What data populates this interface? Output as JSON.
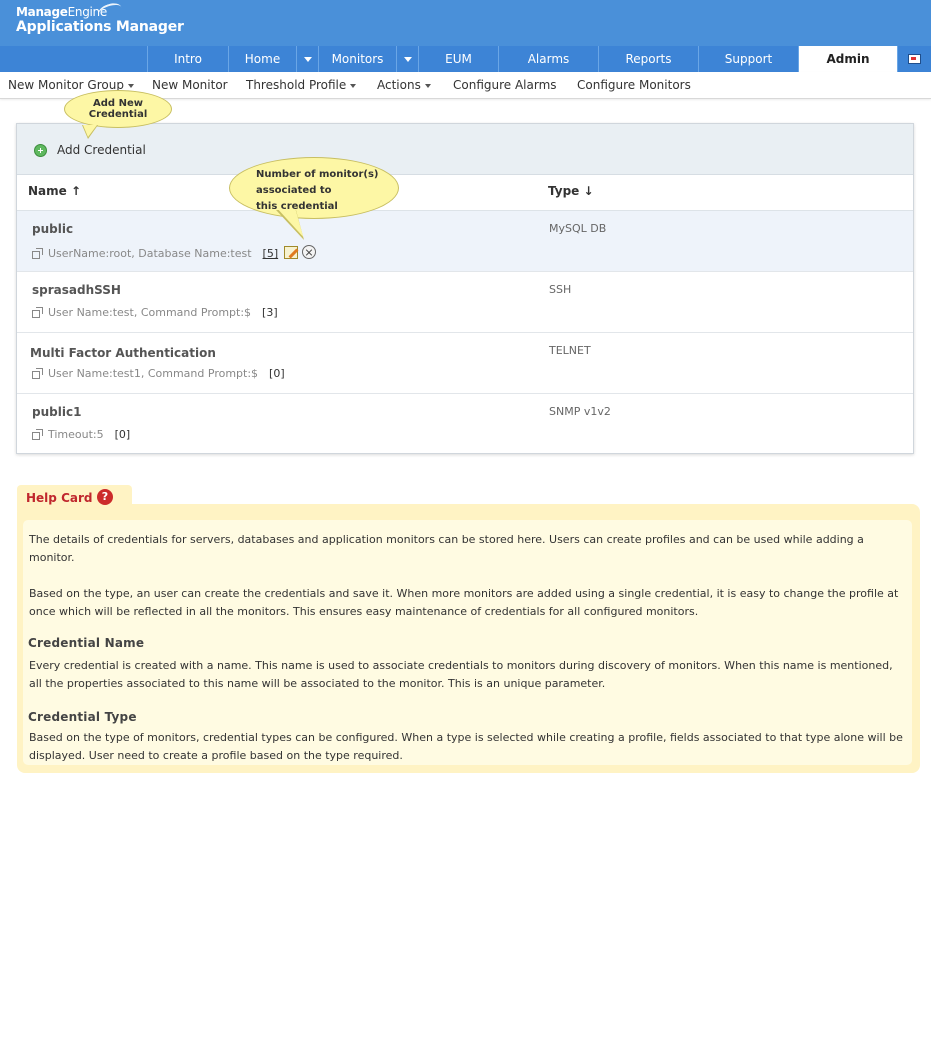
{
  "app": {
    "brand_prefix": "Manage",
    "brand_suffix": "Engine",
    "product": "Applications Manager"
  },
  "tabs": [
    {
      "label": "Intro"
    },
    {
      "label": "Home"
    },
    {
      "label": "Monitors"
    },
    {
      "label": "EUM"
    },
    {
      "label": "Alarms"
    },
    {
      "label": "Reports"
    },
    {
      "label": "Support"
    },
    {
      "label": "Admin",
      "active": true
    }
  ],
  "subnav": {
    "new_monitor_group": "New Monitor Group",
    "new_monitor": "New Monitor",
    "threshold_profile": "Threshold Profile",
    "actions": "Actions",
    "configure_alarms": "Configure Alarms",
    "configure_monitors": "Configure Monitors"
  },
  "callouts": {
    "add_new_line1": "Add New",
    "add_new_line2": "Credential",
    "count_line1": "Number of monitor(s)",
    "count_line2": "associated to",
    "count_line3": "this credential"
  },
  "panel": {
    "add_label": "Add Credential",
    "col_name": "Name",
    "col_name_sort": "↑",
    "col_type": "Type",
    "col_type_sort": "↓",
    "rows": [
      {
        "name": "public",
        "type": "MySQL DB",
        "details": "UserName:root, Database Name:test",
        "count": "[5]"
      },
      {
        "name": "sprasadhSSH",
        "type": "SSH",
        "details": "User Name:test, Command Prompt:$",
        "count": "[3]"
      },
      {
        "name": "Multi Factor Authentication",
        "type": "TELNET",
        "details": "User Name:test1, Command Prompt:$",
        "count": "[0]"
      },
      {
        "name": "public1",
        "type": "SNMP v1v2",
        "details": "Timeout:5",
        "count": "[0]"
      }
    ]
  },
  "help": {
    "title": "Help Card",
    "q_mark": "?",
    "p1": "The details of credentials for servers, databases and application monitors can be stored here. Users can create profiles and can be used while adding a monitor.",
    "p2": "Based on the type, an user can create the credentials and save it. When more monitors are added using a single credential, it is easy to change the profile at once which will be reflected in all the monitors. This ensures easy maintenance of credentials for all configured monitors.",
    "h1": "Credential Name",
    "p3": "Every credential is created with a name. This name is used to associate credentials to monitors during discovery of monitors. When this name is mentioned, all the properties associated to this name will be associated to the monitor. This is an unique parameter.",
    "h2": "Credential Type",
    "p4": "Based on the type of monitors, credential types can be configured. When a type is selected while creating a profile, fields associated to that type alone will be displayed. User need to create a profile based on the type required."
  },
  "colors": {
    "header_blue": "#4a90d9",
    "tab_blue": "#3d84d6",
    "help_bg": "#fff3c4",
    "help_title": "#c0272d",
    "callout_bg": "#fdf7a5"
  }
}
